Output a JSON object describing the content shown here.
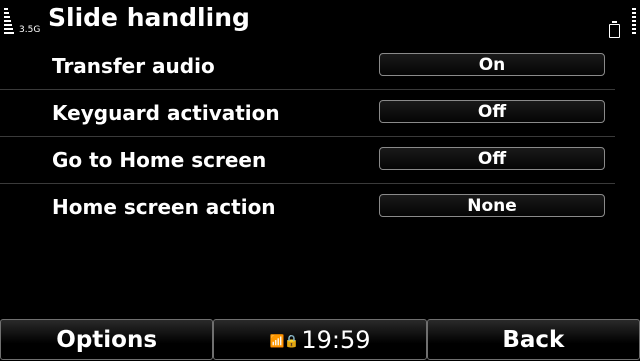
{
  "status": {
    "network_type": "3.5G",
    "title": "Slide handling"
  },
  "settings": [
    {
      "label": "Transfer audio",
      "value": "On"
    },
    {
      "label": "Keyguard activation",
      "value": "Off"
    },
    {
      "label": "Go to Home screen",
      "value": "Off"
    },
    {
      "label": "Home screen action",
      "value": "None"
    }
  ],
  "softkeys": {
    "left": "Options",
    "clock": "19:59",
    "clock_icons": "📶🔒",
    "right": "Back"
  },
  "icons": {
    "signal": "signal-strength-icon",
    "battery": "battery-icon",
    "lock": "keylock-icon"
  }
}
